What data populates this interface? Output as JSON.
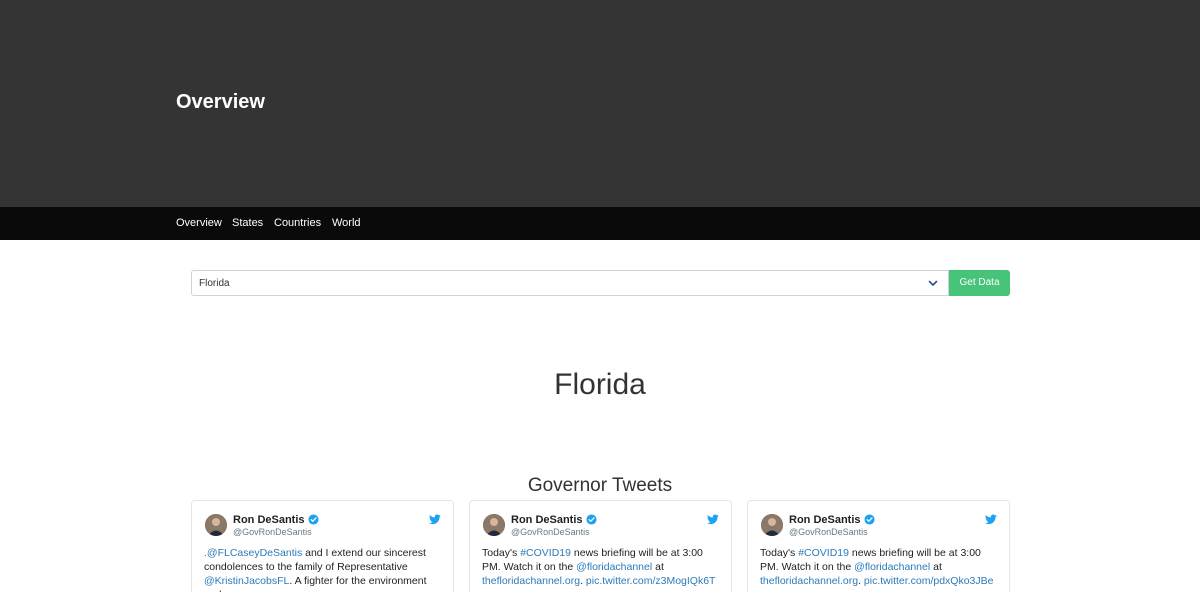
{
  "hero": {
    "title": "Overview"
  },
  "nav": {
    "items": [
      "Overview",
      "States",
      "Countries",
      "World"
    ]
  },
  "selector": {
    "value": "Florida",
    "button_label": "Get Data"
  },
  "state": {
    "title": "Florida"
  },
  "tweets_section": {
    "title": "Governor Tweets"
  },
  "tweets": [
    {
      "name": "Ron DeSantis",
      "handle": "@GovRonDeSantis",
      "segments": [
        {
          "text": ".@FLCaseyDeSantis",
          "link": true
        },
        {
          "text": " and I extend our sincerest condolences to the family of Representative ",
          "link": false
        },
        {
          "text": "@KristinJacobsFL",
          "link": true
        },
        {
          "text": ". A fighter for the environment and",
          "link": false
        }
      ]
    },
    {
      "name": "Ron DeSantis",
      "handle": "@GovRonDeSantis",
      "segments": [
        {
          "text": "Today's ",
          "link": false
        },
        {
          "text": "#COVID19",
          "link": true
        },
        {
          "text": " news briefing will be at 3:00 PM. Watch it on the ",
          "link": false
        },
        {
          "text": "@floridachannel",
          "link": true
        },
        {
          "text": " at ",
          "link": false
        },
        {
          "text": "thefloridachannel.org",
          "link": true
        },
        {
          "text": ". ",
          "link": false
        },
        {
          "text": "pic.twitter.com/z3MogIQk6T",
          "link": true
        }
      ]
    },
    {
      "name": "Ron DeSantis",
      "handle": "@GovRonDeSantis",
      "segments": [
        {
          "text": "Today's ",
          "link": false
        },
        {
          "text": "#COVID19",
          "link": true
        },
        {
          "text": " news briefing will be at 3:00 PM. Watch it on the ",
          "link": false
        },
        {
          "text": "@floridachannel",
          "link": true
        },
        {
          "text": " at ",
          "link": false
        },
        {
          "text": "thefloridachannel.org",
          "link": true
        },
        {
          "text": ". ",
          "link": false
        },
        {
          "text": "pic.twitter.com/pdxQko3JBe",
          "link": true
        }
      ]
    }
  ],
  "colors": {
    "hero_bg": "#343434",
    "nav_bg": "#0a0a0a",
    "button_bg": "#47c37a",
    "link": "#2b7bb9",
    "twitter_blue": "#1da1f2"
  },
  "icons": {
    "select": "chevron-down-icon",
    "verified": "verified-badge-icon",
    "brand": "twitter-bird-icon",
    "avatar": "avatar"
  }
}
